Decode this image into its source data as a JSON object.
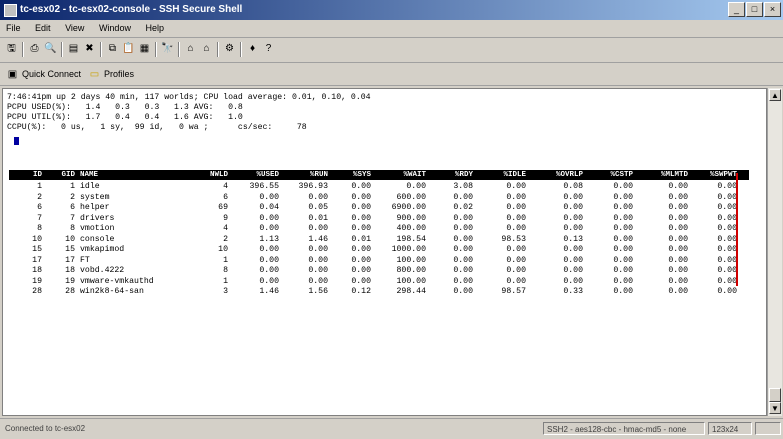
{
  "window": {
    "title": "tc-esx02 - tc-esx02-console - SSH Secure Shell",
    "controls": [
      "_",
      "□",
      "×"
    ]
  },
  "menu": [
    "File",
    "Edit",
    "View",
    "Window",
    "Help"
  ],
  "toolbar": {
    "icons": [
      "save-icon",
      "print-icon",
      "print-preview-icon",
      "new-terminal-icon",
      "disconnect-icon",
      "copy-icon",
      "paste-icon",
      "select-icon",
      "find-icon",
      "profile-icon",
      "profile2-icon",
      "settings-icon",
      "key-icon",
      "help-icon"
    ]
  },
  "quickbar": {
    "quick_connect": "Quick Connect",
    "profiles": "Profiles"
  },
  "terminal": {
    "summary": [
      "7:46:41pm up 2 days 40 min, 117 worlds; CPU load average: 0.01, 0.10, 0.04",
      "PCPU USED(%):   1.4   0.3   0.3   1.3 AVG:   0.8",
      "PCPU UTIL(%):   1.7   0.4   0.4   1.6 AVG:   1.0",
      "CCPU(%):   0 us,   1 sy,  99 id,   0 wa ;      cs/sec:     78"
    ],
    "columns": [
      "ID",
      "GID",
      "NAME",
      "NWLD",
      "%USED",
      "%RUN",
      "%SYS",
      "%WAIT",
      "%RDY",
      "%IDLE",
      "%OVRLP",
      "%CSTP",
      "%MLMTD",
      "%SWPWT"
    ],
    "rows": [
      [
        "1",
        "1",
        "idle",
        "4",
        "396.55",
        "396.93",
        "0.00",
        "0.00",
        "3.08",
        "0.00",
        "0.08",
        "0.00",
        "0.00",
        "0.00"
      ],
      [
        "2",
        "2",
        "system",
        "6",
        "0.00",
        "0.00",
        "0.00",
        "600.00",
        "0.00",
        "0.00",
        "0.00",
        "0.00",
        "0.00",
        "0.00"
      ],
      [
        "6",
        "6",
        "helper",
        "69",
        "0.04",
        "0.05",
        "0.00",
        "6900.00",
        "0.02",
        "0.00",
        "0.00",
        "0.00",
        "0.00",
        "0.00"
      ],
      [
        "7",
        "7",
        "drivers",
        "9",
        "0.00",
        "0.01",
        "0.00",
        "900.00",
        "0.00",
        "0.00",
        "0.00",
        "0.00",
        "0.00",
        "0.00"
      ],
      [
        "8",
        "8",
        "vmotion",
        "4",
        "0.00",
        "0.00",
        "0.00",
        "400.00",
        "0.00",
        "0.00",
        "0.00",
        "0.00",
        "0.00",
        "0.00"
      ],
      [
        "10",
        "10",
        "console",
        "2",
        "1.13",
        "1.46",
        "0.01",
        "198.54",
        "0.00",
        "98.53",
        "0.13",
        "0.00",
        "0.00",
        "0.00"
      ],
      [
        "15",
        "15",
        "vmkapimod",
        "10",
        "0.00",
        "0.00",
        "0.00",
        "1000.00",
        "0.00",
        "0.00",
        "0.00",
        "0.00",
        "0.00",
        "0.00"
      ],
      [
        "17",
        "17",
        "FT",
        "1",
        "0.00",
        "0.00",
        "0.00",
        "100.00",
        "0.00",
        "0.00",
        "0.00",
        "0.00",
        "0.00",
        "0.00"
      ],
      [
        "18",
        "18",
        "vobd.4222",
        "8",
        "0.00",
        "0.00",
        "0.00",
        "800.00",
        "0.00",
        "0.00",
        "0.00",
        "0.00",
        "0.00",
        "0.00"
      ],
      [
        "19",
        "19",
        "vmware-vmkauthd",
        "1",
        "0.00",
        "0.00",
        "0.00",
        "100.00",
        "0.00",
        "0.00",
        "0.00",
        "0.00",
        "0.00",
        "0.00"
      ],
      [
        "28",
        "28",
        "win2k8-64-san",
        "3",
        "1.46",
        "1.56",
        "0.12",
        "298.44",
        "0.00",
        "98.57",
        "0.33",
        "0.00",
        "0.00",
        "0.00"
      ]
    ]
  },
  "status": {
    "connection": "Connected to tc-esx02",
    "cipher": "SSH2 - aes128-cbc - hmac-md5 - none",
    "size": "123x24"
  }
}
